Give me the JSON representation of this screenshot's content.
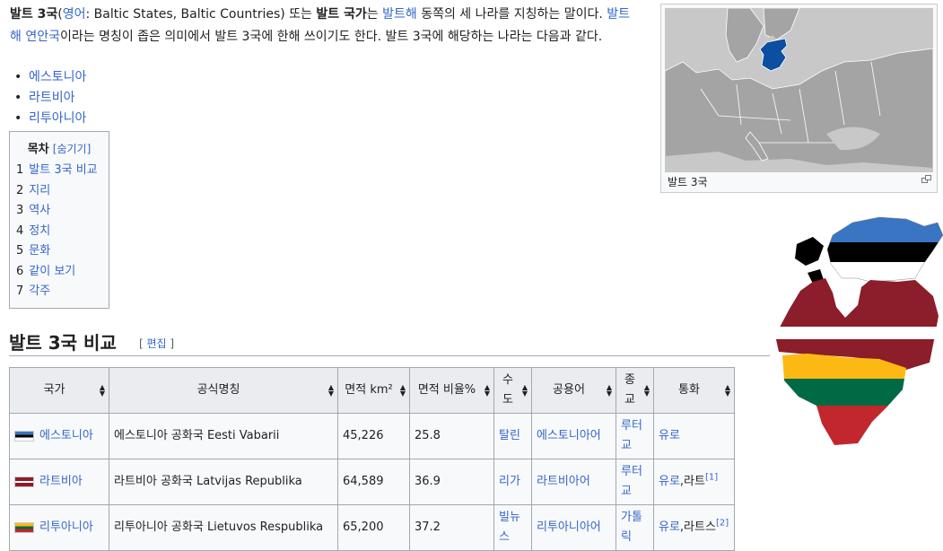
{
  "intro": {
    "p1_bold": "발트 3국",
    "p1_paren_open": "(",
    "p1_lang_link": "영어",
    "p1_paren_text": ": Baltic States, Baltic Countries) 또는 ",
    "p1_bold2": "발트 국가",
    "p1_text2": "는 ",
    "p1_link_baltic_sea": "발트해",
    "p1_text3": " 동쪽의 세 나라를 지칭하는 말이다. ",
    "p1_link_coastal": "발트해 연안국",
    "p1_text4": "이라는 명칭이 좁은 의미에서 발트 3국에 한해 쓰이기도 한다. 발트 3국에 해당하는 나라는 다음과 같다."
  },
  "countries_list": [
    "에스토니아",
    "라트비아",
    "리투아니아"
  ],
  "toc": {
    "title": "목차",
    "toggle": "[숨기기]",
    "items": [
      {
        "num": "1",
        "label": "발트 3국 비교"
      },
      {
        "num": "2",
        "label": "지리"
      },
      {
        "num": "3",
        "label": "역사"
      },
      {
        "num": "4",
        "label": "정치"
      },
      {
        "num": "5",
        "label": "문화"
      },
      {
        "num": "6",
        "label": "같이 보기"
      },
      {
        "num": "7",
        "label": "각주"
      }
    ]
  },
  "thumb": {
    "caption": "발트 3국",
    "enlarge_icon": "enlarge-icon"
  },
  "section": {
    "title": "발트 3국 비교",
    "edit_open": "[ ",
    "edit_label": "편집",
    "edit_close": " ]"
  },
  "table": {
    "headers": [
      "국가",
      "공식명칭",
      "면적 km²",
      "면적 비율%",
      "수도",
      "공용어",
      "종교",
      "통화"
    ],
    "rows": [
      {
        "country": "에스토니아",
        "official": "에스토니아 공화국 Eesti Vabarii",
        "area": "45,226",
        "ratio": "25.8",
        "capital": "탈린",
        "language": "에스토니아어",
        "religion": "루터교",
        "currency": "유로",
        "currency_extra": "",
        "note": ""
      },
      {
        "country": "라트비아",
        "official": "라트비아 공화국 Latvijas Republika",
        "area": "64,589",
        "ratio": "36.9",
        "capital": "리가",
        "language": "라트비아어",
        "religion": "루터교",
        "currency": "유로",
        "currency_extra": ",라트",
        "note": "[1]"
      },
      {
        "country": "리투아니아",
        "official": "리투아니아 공화국 Lietuvos Respublika",
        "area": "65,200",
        "ratio": "37.2",
        "capital": "빌뉴스",
        "language": "리투아니아어",
        "religion": "가톨릭",
        "currency": "유로",
        "currency_extra": ",라트스",
        "note": "[2]"
      }
    ]
  },
  "colors": {
    "link": "#3366cc",
    "estonia_blue": "#3a75c4",
    "latvia_red": "#8c1d2a",
    "lithuania_yellow": "#fdb913",
    "lithuania_green": "#006a44",
    "lithuania_red": "#c1272d",
    "map_highlight": "#0b4ea2"
  }
}
